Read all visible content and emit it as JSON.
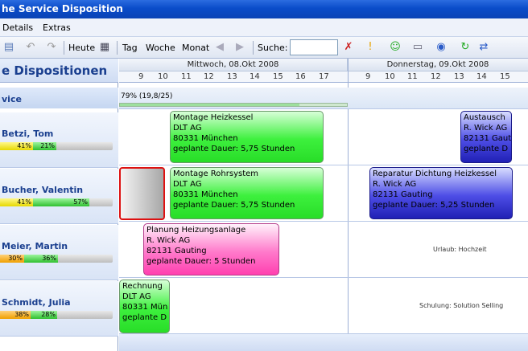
{
  "window": {
    "title": "he Service Disposition"
  },
  "menu": [
    "Details",
    "Extras"
  ],
  "toolbar": {
    "heute": "Heute",
    "tag": "Tag",
    "woche": "Woche",
    "monat": "Monat",
    "suche_label": "Suche:",
    "suche_value": ""
  },
  "panel": {
    "title": "e Dispositionen",
    "group": "vice",
    "resources": [
      {
        "name": "Betzi, Tom",
        "p1": "41%",
        "p2": "21%",
        "f1": 41,
        "f2": 21
      },
      {
        "name": "Bucher, Valentin",
        "p1": "41%",
        "p2": "57%",
        "f1": 41,
        "f2": 57
      },
      {
        "name": "Meier, Martin",
        "p1": "30%",
        "p2": "36%",
        "f1": 30,
        "f2": 36
      },
      {
        "name": "Schmidt, Julia",
        "p1": "38%",
        "p2": "28%",
        "f1": 38,
        "f2": 28
      }
    ]
  },
  "schedule": {
    "day1": "Mittwoch, 08.Okt 2008",
    "day2": "Donnerstag, 09.Okt 2008",
    "hours1": [
      "9",
      "10",
      "11",
      "12",
      "13",
      "14",
      "15",
      "16",
      "17"
    ],
    "hours2": [
      "9",
      "10",
      "11",
      "12",
      "13",
      "14",
      "15"
    ],
    "group_progress": "79% (19,8/25)",
    "group_progress_value": 79,
    "appointments": [
      {
        "id": "a1",
        "line1": "Montage Heizkessel",
        "line2": "DLT AG",
        "line3": "80331 München",
        "line4": "geplante Dauer: 5,75 Stunden"
      },
      {
        "id": "a2",
        "line1": "Austausch",
        "line2": "R. Wick AG",
        "line3": "82131 Gaut",
        "line4": "geplante D"
      },
      {
        "id": "a3",
        "line1": "Montage Rohrsystem",
        "line2": "DLT AG",
        "line3": "80331 München",
        "line4": "geplante Dauer: 5,75 Stunden"
      },
      {
        "id": "a4",
        "line1": "Reparatur Dichtung Heizkessel",
        "line2": "R. Wick AG",
        "line3": "82131 Gauting",
        "line4": "geplante Dauer: 5,25 Stunden"
      },
      {
        "id": "a5",
        "line1": "Planung Heizungsanlage",
        "line2": "R. Wick AG",
        "line3": "82131 Gauting",
        "line4": "geplante Dauer: 5 Stunden"
      },
      {
        "id": "a6",
        "line1": "Rechnung",
        "line2": "DLT AG",
        "line3": "80331 Mün",
        "line4": "geplante D"
      }
    ],
    "notes": {
      "meier": "Urlaub: Hochzeit",
      "schmidt": "Schulung: Solution Selling"
    }
  }
}
